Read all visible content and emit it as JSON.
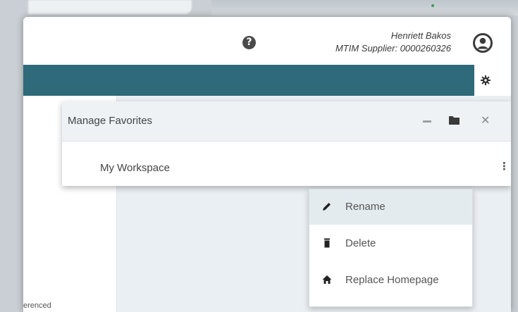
{
  "header": {
    "user_name": "Henriett Bakos",
    "user_org": "MTIM Supplier: 0000260326",
    "help_icon_glyph": "?"
  },
  "favorites_panel": {
    "title": "Manage Favorites",
    "items": [
      {
        "label": "My Workspace"
      }
    ],
    "close_glyph": "✕",
    "kebab_glyph": "⋮"
  },
  "context_menu": {
    "items": [
      {
        "label": "Rename",
        "icon": "pencil-icon"
      },
      {
        "label": "Delete",
        "icon": "trash-icon"
      },
      {
        "label": "Replace Homepage",
        "icon": "home-icon"
      }
    ]
  },
  "left_panel": {
    "partial_text": "erenced",
    "kebab_glyph": "⋮"
  },
  "colors": {
    "teal_bar": "#2e6a7a",
    "panel_header": "#eef2f5",
    "menu_highlight": "#e4ebef"
  }
}
